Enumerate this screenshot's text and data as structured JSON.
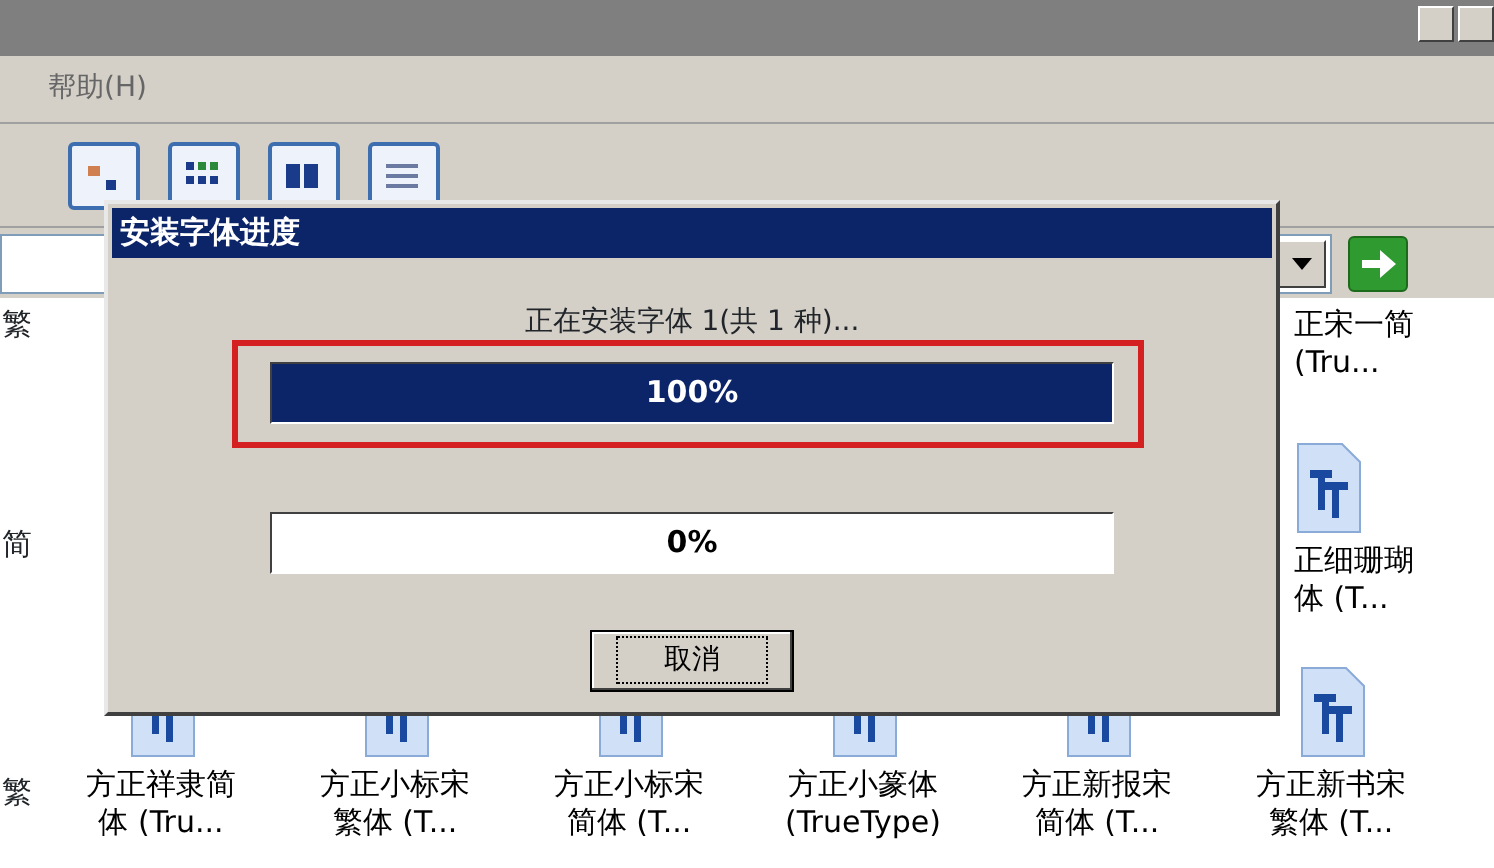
{
  "menu": [
    "帮助(H)"
  ],
  "files": {
    "left_edge": [
      "繁",
      "简",
      "繁"
    ],
    "right_column": [
      {
        "lines": [
          "正宋一简",
          "(Tru..."
        ],
        "icon": false
      },
      {
        "lines": [
          "正细珊瑚",
          "体 (T..."
        ],
        "icon": true
      }
    ],
    "bottom_row": [
      {
        "lines": [
          "方正祥隶简",
          "体 (Tru..."
        ],
        "icon": true
      },
      {
        "lines": [
          "方正小标宋",
          "繁体 (T..."
        ],
        "icon": true
      },
      {
        "lines": [
          "方正小标宋",
          "简体 (T..."
        ],
        "icon": true
      },
      {
        "lines": [
          "方正小篆体",
          "(TrueType)"
        ],
        "icon": true
      },
      {
        "lines": [
          "方正新报宋",
          "简体 (T..."
        ],
        "icon": true
      },
      {
        "lines": [
          "方正新书宋",
          "繁体 (T..."
        ],
        "icon": true
      }
    ]
  },
  "dialog": {
    "title": "安装字体进度",
    "message": "正在安装字体 1(共 1 种)...",
    "progress": [
      {
        "label": "100%",
        "level": 1,
        "highlighted": true
      },
      {
        "label": "0%",
        "level": 0,
        "highlighted": false
      }
    ],
    "button": {
      "label": "取消",
      "focused": true
    }
  }
}
